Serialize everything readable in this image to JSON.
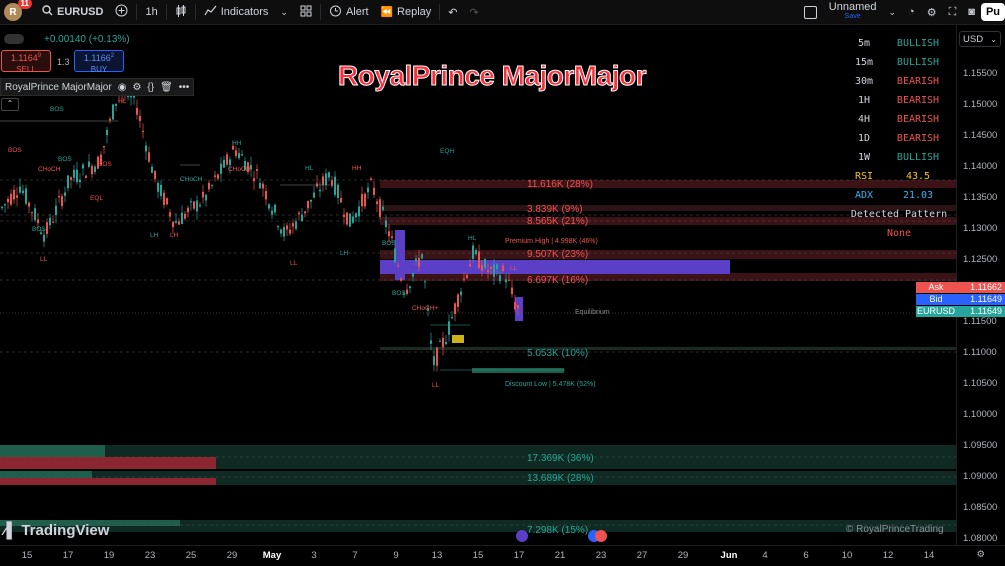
{
  "toolbar": {
    "avatar_letter": "R",
    "notif_count": "11",
    "symbol": "EURUSD",
    "timeframe": "1h",
    "indicators": "Indicators",
    "alert": "Alert",
    "replay": "Replay",
    "layout_name": "Unnamed",
    "layout_save": "Save",
    "publish": "Pu"
  },
  "legend": {
    "change": "+0.00140 (+0.13%)",
    "sell_price": "1.1164",
    "sell_sup": "9",
    "sell_label": "SELL",
    "spread": "1.3",
    "buy_price": "1.1166",
    "buy_sup": "2",
    "buy_label": "BUY",
    "indicator_name": "RoyalPrince MajorMajor"
  },
  "chart_title": "RoyalPrince MajorMajor",
  "currency": "USD",
  "price_ticks": [
    "1.15500",
    "1.15000",
    "1.14500",
    "1.14000",
    "1.13500",
    "1.13000",
    "1.12500",
    "1.12000",
    "1.11500",
    "1.11000",
    "1.10500",
    "1.10000",
    "1.09500",
    "1.09000",
    "1.08500",
    "1.08000"
  ],
  "date_ticks": [
    "15",
    "17",
    "19",
    "23",
    "25",
    "29",
    "May",
    "3",
    "7",
    "9",
    "13",
    "15",
    "17",
    "21",
    "23",
    "27",
    "29",
    "Jun",
    "4",
    "6",
    "10",
    "12",
    "14"
  ],
  "price_labels": {
    "ask_label": "Ask",
    "ask": "1.11662",
    "bid_label": "Bid",
    "bid": "1.11649",
    "sym_label": "EURUSD",
    "last": "1.11649"
  },
  "trend_table": [
    {
      "tf": "5m",
      "state": "BULLISH",
      "color": "#26a69a"
    },
    {
      "tf": "15m",
      "state": "BULLISH",
      "color": "#26a69a"
    },
    {
      "tf": "30m",
      "state": "BEARISH",
      "color": "#ef5350"
    },
    {
      "tf": "1H",
      "state": "BEARISH",
      "color": "#ef5350"
    },
    {
      "tf": "4H",
      "state": "BEARISH",
      "color": "#ef5350"
    },
    {
      "tf": "1D",
      "state": "BEARISH",
      "color": "#ef5350"
    },
    {
      "tf": "1W",
      "state": "BULLISH",
      "color": "#26a69a"
    }
  ],
  "rsi": {
    "label": "RSI",
    "value": "43.5"
  },
  "adx": {
    "label": "ADX",
    "value": "21.03"
  },
  "pattern": {
    "label": "Detected Pattern",
    "value": "None"
  },
  "volume_zones": [
    "11.616K (28%)",
    "3.839K (9%)",
    "8.565K (21%)",
    "9.507K (23%)",
    "6.697K (16%)",
    "5.053K (10%)",
    "17.369K (36%)",
    "13.689K (28%)",
    "7.298K (15%)"
  ],
  "annotations": {
    "premium_high": "Premium High | 4.998K (46%)",
    "equilibrium": "Equilibrium",
    "discount_low": "Discount Low | 5.478K (52%)"
  },
  "structure_labels": [
    "BOS",
    "BOS",
    "BOS",
    "BOS",
    "BOS",
    "CHoCH",
    "CHoCH",
    "CHoCH",
    "HH",
    "HL",
    "LH",
    "LH",
    "LL",
    "LL",
    "LH",
    "HH",
    "HL",
    "LL",
    "EQH",
    "EQL",
    "BOS",
    "CHoCH+",
    "HL",
    "LL",
    "BOS"
  ],
  "watermark": "TradingView",
  "copyright": "© RoyalPrinceTrading",
  "colors": {
    "bull": "#26a69a",
    "bear": "#ef5350",
    "title": "#ff2d3a",
    "purple": "#5b3fc7"
  }
}
